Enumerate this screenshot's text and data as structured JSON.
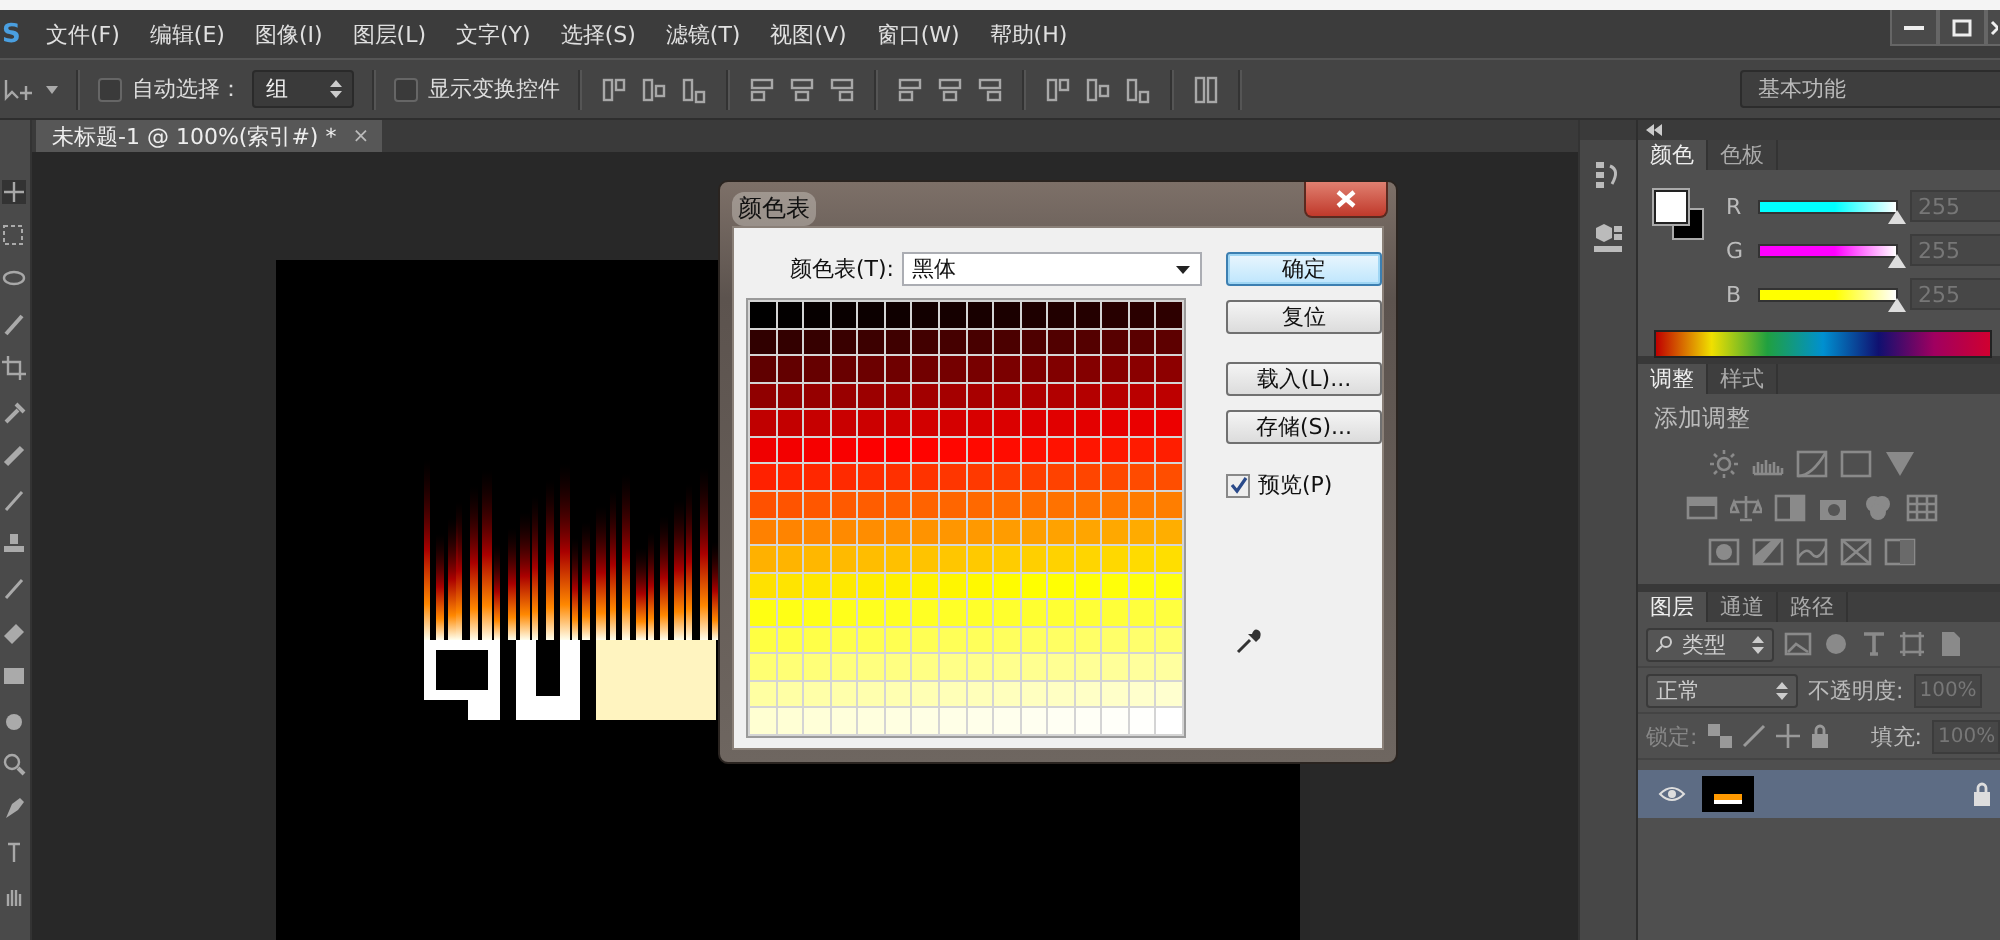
{
  "app": {
    "logo": "S"
  },
  "menu": [
    "文件(F)",
    "编辑(E)",
    "图像(I)",
    "图层(L)",
    "文字(Y)",
    "选择(S)",
    "滤镜(T)",
    "视图(V)",
    "窗口(W)",
    "帮助(H)"
  ],
  "options_bar": {
    "auto_select": {
      "label": "自动选择：",
      "checked": false
    },
    "auto_select_target": "组",
    "show_transform": {
      "label": "显示变换控件",
      "checked": false
    },
    "workspace": "基本功能"
  },
  "document_tab": {
    "title": "未标题-1 @ 100%(索引#) *",
    "close": "×",
    "selected": true
  },
  "color_table_dialog": {
    "title": "颜色表",
    "table_label": "颜色表(T):",
    "table_value": "黑体",
    "swatch_rows": [
      [
        {
          "color": "#000000"
        },
        {
          "color": "#030000"
        },
        {
          "color": "#060000"
        },
        {
          "color": "#090000"
        },
        {
          "color": "#0c0000"
        },
        {
          "color": "#0f0000"
        },
        {
          "color": "#120000"
        },
        {
          "color": "#150000"
        },
        {
          "color": "#180000"
        },
        {
          "color": "#1b0000"
        },
        {
          "color": "#1e0000"
        },
        {
          "color": "#210000"
        },
        {
          "color": "#240000"
        },
        {
          "color": "#270000"
        },
        {
          "color": "#2a0000"
        },
        {
          "color": "#2d0000"
        }
      ],
      [
        {
          "color": "#300000"
        },
        {
          "color": "#330000"
        },
        {
          "color": "#360000"
        },
        {
          "color": "#390000"
        },
        {
          "color": "#3c0000"
        },
        {
          "color": "#3f0000"
        },
        {
          "color": "#420000"
        },
        {
          "color": "#450000"
        },
        {
          "color": "#480000"
        },
        {
          "color": "#4b0000"
        },
        {
          "color": "#4e0000"
        },
        {
          "color": "#510000"
        },
        {
          "color": "#540000"
        },
        {
          "color": "#570000"
        },
        {
          "color": "#5a0000"
        },
        {
          "color": "#5d0000"
        }
      ],
      [
        {
          "color": "#600000"
        },
        {
          "color": "#630000"
        },
        {
          "color": "#660000"
        },
        {
          "color": "#690000"
        },
        {
          "color": "#6c0000"
        },
        {
          "color": "#6f0000"
        },
        {
          "color": "#720000"
        },
        {
          "color": "#750000"
        },
        {
          "color": "#780000"
        },
        {
          "color": "#7b0000"
        },
        {
          "color": "#7e0000"
        },
        {
          "color": "#810000"
        },
        {
          "color": "#840000"
        },
        {
          "color": "#870000"
        },
        {
          "color": "#8a0000"
        },
        {
          "color": "#8d0000"
        }
      ],
      [
        {
          "color": "#900000"
        },
        {
          "color": "#930000"
        },
        {
          "color": "#960000"
        },
        {
          "color": "#990000"
        },
        {
          "color": "#9c0000"
        },
        {
          "color": "#9f0000"
        },
        {
          "color": "#a20000"
        },
        {
          "color": "#a50000"
        },
        {
          "color": "#a80000"
        },
        {
          "color": "#ab0000"
        },
        {
          "color": "#ae0000"
        },
        {
          "color": "#b10000"
        },
        {
          "color": "#b40000"
        },
        {
          "color": "#b70000"
        },
        {
          "color": "#ba0000"
        },
        {
          "color": "#bd0000"
        }
      ],
      [
        {
          "color": "#c00000"
        },
        {
          "color": "#c30000"
        },
        {
          "color": "#c60000"
        },
        {
          "color": "#c90000"
        },
        {
          "color": "#cc0000"
        },
        {
          "color": "#cf0000"
        },
        {
          "color": "#d20000"
        },
        {
          "color": "#d50000"
        },
        {
          "color": "#d80000"
        },
        {
          "color": "#db0000"
        },
        {
          "color": "#de0000"
        },
        {
          "color": "#e10000"
        },
        {
          "color": "#e40000"
        },
        {
          "color": "#e70000"
        },
        {
          "color": "#ea0000"
        },
        {
          "color": "#ed0000"
        }
      ],
      [
        {
          "color": "#f00000"
        },
        {
          "color": "#f30000"
        },
        {
          "color": "#f60000"
        },
        {
          "color": "#f90000"
        },
        {
          "color": "#fc0000"
        },
        {
          "color": "#ff0000"
        },
        {
          "color": "#ff0300"
        },
        {
          "color": "#ff0600"
        },
        {
          "color": "#ff0900"
        },
        {
          "color": "#ff0c00"
        },
        {
          "color": "#ff0f00"
        },
        {
          "color": "#ff1200"
        },
        {
          "color": "#ff1500"
        },
        {
          "color": "#ff1800"
        },
        {
          "color": "#ff1b00"
        },
        {
          "color": "#ff1e00"
        }
      ],
      [
        {
          "color": "#ff2100"
        },
        {
          "color": "#ff2400"
        },
        {
          "color": "#ff2700"
        },
        {
          "color": "#ff2a00"
        },
        {
          "color": "#ff2d00"
        },
        {
          "color": "#ff3000"
        },
        {
          "color": "#ff3300"
        },
        {
          "color": "#ff3600"
        },
        {
          "color": "#ff3900"
        },
        {
          "color": "#ff3c00"
        },
        {
          "color": "#ff3f00"
        },
        {
          "color": "#ff4200"
        },
        {
          "color": "#ff4500"
        },
        {
          "color": "#ff4800"
        },
        {
          "color": "#ff4b00"
        },
        {
          "color": "#ff4e00"
        }
      ],
      [
        {
          "color": "#ff5100"
        },
        {
          "color": "#ff5400"
        },
        {
          "color": "#ff5700"
        },
        {
          "color": "#ff5a00"
        },
        {
          "color": "#ff5d00"
        },
        {
          "color": "#ff6000"
        },
        {
          "color": "#ff6300"
        },
        {
          "color": "#ff6600"
        },
        {
          "color": "#ff6900"
        },
        {
          "color": "#ff6c00"
        },
        {
          "color": "#ff6f00"
        },
        {
          "color": "#ff7200"
        },
        {
          "color": "#ff7500"
        },
        {
          "color": "#ff7800"
        },
        {
          "color": "#ff7b00"
        },
        {
          "color": "#ff7e00"
        }
      ],
      [
        {
          "color": "#ff8100"
        },
        {
          "color": "#ff8400"
        },
        {
          "color": "#ff8700"
        },
        {
          "color": "#ff8a00"
        },
        {
          "color": "#ff8d00"
        },
        {
          "color": "#ff9000"
        },
        {
          "color": "#ff9300"
        },
        {
          "color": "#ff9600"
        },
        {
          "color": "#ff9900"
        },
        {
          "color": "#ff9c00"
        },
        {
          "color": "#ff9f00"
        },
        {
          "color": "#ffa200"
        },
        {
          "color": "#ffa500"
        },
        {
          "color": "#ffa800"
        },
        {
          "color": "#ffab00"
        },
        {
          "color": "#ffae00"
        }
      ],
      [
        {
          "color": "#ffb100"
        },
        {
          "color": "#ffb400"
        },
        {
          "color": "#ffb700"
        },
        {
          "color": "#ffba00"
        },
        {
          "color": "#ffbd00"
        },
        {
          "color": "#ffc000"
        },
        {
          "color": "#ffc300"
        },
        {
          "color": "#ffc600"
        },
        {
          "color": "#ffc900"
        },
        {
          "color": "#ffcc00"
        },
        {
          "color": "#ffcf00"
        },
        {
          "color": "#ffd200"
        },
        {
          "color": "#ffd500"
        },
        {
          "color": "#ffd800"
        },
        {
          "color": "#ffdb00"
        },
        {
          "color": "#ffde00"
        }
      ],
      [
        {
          "color": "#ffe100"
        },
        {
          "color": "#ffe400"
        },
        {
          "color": "#ffe700"
        },
        {
          "color": "#ffea00"
        },
        {
          "color": "#ffed00"
        },
        {
          "color": "#fff000"
        },
        {
          "color": "#fff300"
        },
        {
          "color": "#fff600"
        },
        {
          "color": "#fff900"
        },
        {
          "color": "#fffc00"
        },
        {
          "color": "#ffff00"
        },
        {
          "color": "#ffff03"
        },
        {
          "color": "#ffff06"
        },
        {
          "color": "#ffff09"
        },
        {
          "color": "#ffff0c"
        },
        {
          "color": "#ffff0f"
        }
      ],
      [
        {
          "color": "#ffff12"
        },
        {
          "color": "#ffff15"
        },
        {
          "color": "#ffff18"
        },
        {
          "color": "#ffff1b"
        },
        {
          "color": "#ffff1e"
        },
        {
          "color": "#ffff21"
        },
        {
          "color": "#ffff24"
        },
        {
          "color": "#ffff27"
        },
        {
          "color": "#ffff2a"
        },
        {
          "color": "#ffff2d"
        },
        {
          "color": "#ffff30"
        },
        {
          "color": "#ffff33"
        },
        {
          "color": "#ffff36"
        },
        {
          "color": "#ffff39"
        },
        {
          "color": "#ffff3c"
        },
        {
          "color": "#ffff3f"
        }
      ],
      [
        {
          "color": "#ffff42"
        },
        {
          "color": "#ffff45"
        },
        {
          "color": "#ffff48"
        },
        {
          "color": "#ffff4b"
        },
        {
          "color": "#ffff4e"
        },
        {
          "color": "#ffff51"
        },
        {
          "color": "#ffff54"
        },
        {
          "color": "#ffff57"
        },
        {
          "color": "#ffff5a"
        },
        {
          "color": "#ffff5d"
        },
        {
          "color": "#ffff60"
        },
        {
          "color": "#ffff63"
        },
        {
          "color": "#ffff66"
        },
        {
          "color": "#ffff69"
        },
        {
          "color": "#ffff6c"
        },
        {
          "color": "#ffff6f"
        }
      ],
      [
        {
          "color": "#ffff72"
        },
        {
          "color": "#ffff75"
        },
        {
          "color": "#ffff78"
        },
        {
          "color": "#ffff7b"
        },
        {
          "color": "#ffff7e"
        },
        {
          "color": "#ffff81"
        },
        {
          "color": "#ffff84"
        },
        {
          "color": "#ffff87"
        },
        {
          "color": "#ffff8a"
        },
        {
          "color": "#ffff8d"
        },
        {
          "color": "#ffff90"
        },
        {
          "color": "#ffff93"
        },
        {
          "color": "#ffff96"
        },
        {
          "color": "#ffff99"
        },
        {
          "color": "#ffff9c"
        },
        {
          "color": "#ffff9f"
        }
      ],
      [
        {
          "color": "#ffffa2"
        },
        {
          "color": "#ffffa5"
        },
        {
          "color": "#ffffa8"
        },
        {
          "color": "#ffffab"
        },
        {
          "color": "#ffffae"
        },
        {
          "color": "#ffffb1"
        },
        {
          "color": "#ffffb4"
        },
        {
          "color": "#ffffb7"
        },
        {
          "color": "#ffffba"
        },
        {
          "color": "#ffffbd"
        },
        {
          "color": "#ffffc0"
        },
        {
          "color": "#ffffc3"
        },
        {
          "color": "#ffffc6"
        },
        {
          "color": "#ffffc9"
        },
        {
          "color": "#ffffcc"
        },
        {
          "color": "#ffffcf"
        }
      ],
      [
        {
          "color": "#ffffd2"
        },
        {
          "color": "#ffffd5"
        },
        {
          "color": "#ffffd8"
        },
        {
          "color": "#ffffdb"
        },
        {
          "color": "#ffffde"
        },
        {
          "color": "#ffffe1"
        },
        {
          "color": "#ffffe4"
        },
        {
          "color": "#ffffe7"
        },
        {
          "color": "#ffffea"
        },
        {
          "color": "#ffffed"
        },
        {
          "color": "#fffff0"
        },
        {
          "color": "#fffff3"
        },
        {
          "color": "#fffff6"
        },
        {
          "color": "#fffff9"
        },
        {
          "color": "#fffffc"
        },
        {
          "color": "#ffffff"
        }
      ]
    ],
    "buttons": [
      {
        "label": "确定",
        "default": true
      },
      {
        "label": "复位",
        "default": false
      },
      {
        "label": "载入(L)...",
        "default": false
      },
      {
        "label": "存储(S)...",
        "default": false
      }
    ],
    "preview": {
      "label": "预览(P)",
      "checked": true
    }
  },
  "color_panel": {
    "tabs": [
      {
        "label": "颜色",
        "selected": true
      },
      {
        "label": "色板",
        "selected": false
      }
    ],
    "foreground": {
      "color": "#ffffff"
    },
    "background": {
      "color": "#000000"
    },
    "channels": [
      {
        "name": "R",
        "color": "#00ffff",
        "level": 1,
        "value": "255"
      },
      {
        "name": "G",
        "color": "#ff00ff",
        "level": 1,
        "value": "255"
      },
      {
        "name": "B",
        "color": "#ffff00",
        "level": 1,
        "value": "255"
      }
    ]
  },
  "adjustments_panel": {
    "tabs": [
      {
        "label": "调整",
        "selected": true
      },
      {
        "label": "样式",
        "selected": false
      }
    ],
    "heading": "添加调整"
  },
  "layers_panel": {
    "tabs": [
      {
        "label": "图层",
        "selected": true
      },
      {
        "label": "通道",
        "selected": false
      },
      {
        "label": "路径",
        "selected": false
      }
    ],
    "filter": "类型",
    "blend_mode": "正常",
    "opacity_label": "不透明度:",
    "opacity": "100%",
    "lock_label": "锁定:",
    "fill_label": "填充:",
    "fill": "100%",
    "layers": [
      {
        "selected": true,
        "visible": true,
        "locked": true
      }
    ]
  }
}
